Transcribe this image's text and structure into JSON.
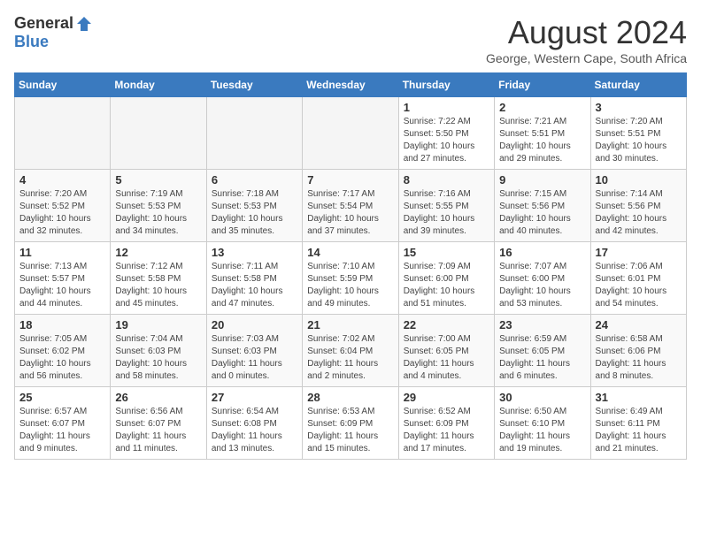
{
  "header": {
    "logo_general": "General",
    "logo_blue": "Blue",
    "month_title": "August 2024",
    "location": "George, Western Cape, South Africa"
  },
  "days_of_week": [
    "Sunday",
    "Monday",
    "Tuesday",
    "Wednesday",
    "Thursday",
    "Friday",
    "Saturday"
  ],
  "weeks": [
    [
      {
        "day": "",
        "empty": true
      },
      {
        "day": "",
        "empty": true
      },
      {
        "day": "",
        "empty": true
      },
      {
        "day": "",
        "empty": true
      },
      {
        "day": "1",
        "sunrise": "7:22 AM",
        "sunset": "5:50 PM",
        "daylight": "10 hours and 27 minutes."
      },
      {
        "day": "2",
        "sunrise": "7:21 AM",
        "sunset": "5:51 PM",
        "daylight": "10 hours and 29 minutes."
      },
      {
        "day": "3",
        "sunrise": "7:20 AM",
        "sunset": "5:51 PM",
        "daylight": "10 hours and 30 minutes."
      }
    ],
    [
      {
        "day": "4",
        "sunrise": "7:20 AM",
        "sunset": "5:52 PM",
        "daylight": "10 hours and 32 minutes."
      },
      {
        "day": "5",
        "sunrise": "7:19 AM",
        "sunset": "5:53 PM",
        "daylight": "10 hours and 34 minutes."
      },
      {
        "day": "6",
        "sunrise": "7:18 AM",
        "sunset": "5:53 PM",
        "daylight": "10 hours and 35 minutes."
      },
      {
        "day": "7",
        "sunrise": "7:17 AM",
        "sunset": "5:54 PM",
        "daylight": "10 hours and 37 minutes."
      },
      {
        "day": "8",
        "sunrise": "7:16 AM",
        "sunset": "5:55 PM",
        "daylight": "10 hours and 39 minutes."
      },
      {
        "day": "9",
        "sunrise": "7:15 AM",
        "sunset": "5:56 PM",
        "daylight": "10 hours and 40 minutes."
      },
      {
        "day": "10",
        "sunrise": "7:14 AM",
        "sunset": "5:56 PM",
        "daylight": "10 hours and 42 minutes."
      }
    ],
    [
      {
        "day": "11",
        "sunrise": "7:13 AM",
        "sunset": "5:57 PM",
        "daylight": "10 hours and 44 minutes."
      },
      {
        "day": "12",
        "sunrise": "7:12 AM",
        "sunset": "5:58 PM",
        "daylight": "10 hours and 45 minutes."
      },
      {
        "day": "13",
        "sunrise": "7:11 AM",
        "sunset": "5:58 PM",
        "daylight": "10 hours and 47 minutes."
      },
      {
        "day": "14",
        "sunrise": "7:10 AM",
        "sunset": "5:59 PM",
        "daylight": "10 hours and 49 minutes."
      },
      {
        "day": "15",
        "sunrise": "7:09 AM",
        "sunset": "6:00 PM",
        "daylight": "10 hours and 51 minutes."
      },
      {
        "day": "16",
        "sunrise": "7:07 AM",
        "sunset": "6:00 PM",
        "daylight": "10 hours and 53 minutes."
      },
      {
        "day": "17",
        "sunrise": "7:06 AM",
        "sunset": "6:01 PM",
        "daylight": "10 hours and 54 minutes."
      }
    ],
    [
      {
        "day": "18",
        "sunrise": "7:05 AM",
        "sunset": "6:02 PM",
        "daylight": "10 hours and 56 minutes."
      },
      {
        "day": "19",
        "sunrise": "7:04 AM",
        "sunset": "6:03 PM",
        "daylight": "10 hours and 58 minutes."
      },
      {
        "day": "20",
        "sunrise": "7:03 AM",
        "sunset": "6:03 PM",
        "daylight": "11 hours and 0 minutes."
      },
      {
        "day": "21",
        "sunrise": "7:02 AM",
        "sunset": "6:04 PM",
        "daylight": "11 hours and 2 minutes."
      },
      {
        "day": "22",
        "sunrise": "7:00 AM",
        "sunset": "6:05 PM",
        "daylight": "11 hours and 4 minutes."
      },
      {
        "day": "23",
        "sunrise": "6:59 AM",
        "sunset": "6:05 PM",
        "daylight": "11 hours and 6 minutes."
      },
      {
        "day": "24",
        "sunrise": "6:58 AM",
        "sunset": "6:06 PM",
        "daylight": "11 hours and 8 minutes."
      }
    ],
    [
      {
        "day": "25",
        "sunrise": "6:57 AM",
        "sunset": "6:07 PM",
        "daylight": "11 hours and 9 minutes."
      },
      {
        "day": "26",
        "sunrise": "6:56 AM",
        "sunset": "6:07 PM",
        "daylight": "11 hours and 11 minutes."
      },
      {
        "day": "27",
        "sunrise": "6:54 AM",
        "sunset": "6:08 PM",
        "daylight": "11 hours and 13 minutes."
      },
      {
        "day": "28",
        "sunrise": "6:53 AM",
        "sunset": "6:09 PM",
        "daylight": "11 hours and 15 minutes."
      },
      {
        "day": "29",
        "sunrise": "6:52 AM",
        "sunset": "6:09 PM",
        "daylight": "11 hours and 17 minutes."
      },
      {
        "day": "30",
        "sunrise": "6:50 AM",
        "sunset": "6:10 PM",
        "daylight": "11 hours and 19 minutes."
      },
      {
        "day": "31",
        "sunrise": "6:49 AM",
        "sunset": "6:11 PM",
        "daylight": "11 hours and 21 minutes."
      }
    ]
  ],
  "labels": {
    "sunrise": "Sunrise:",
    "sunset": "Sunset:",
    "daylight": "Daylight:"
  }
}
